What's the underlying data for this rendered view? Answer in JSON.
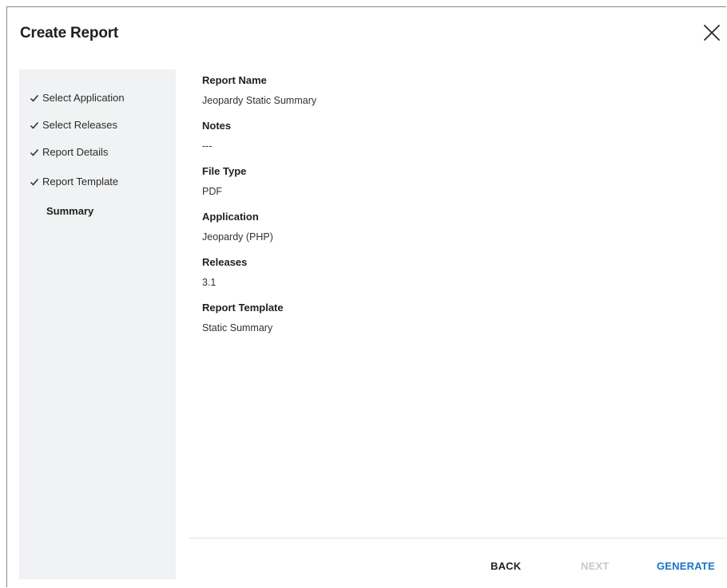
{
  "dialog": {
    "title": "Create Report",
    "close_icon": "close-icon"
  },
  "sidebar": {
    "steps": [
      {
        "label": "Select Application",
        "completed": true,
        "icon": "checkmark-icon"
      },
      {
        "label": "Select Releases",
        "completed": true,
        "icon": "checkmark-icon"
      },
      {
        "label": "Report Details",
        "completed": true,
        "icon": "checkmark-icon"
      },
      {
        "label": "Report Template",
        "completed": true,
        "icon": "checkmark-icon"
      },
      {
        "label": "Summary",
        "completed": false,
        "current": true
      }
    ]
  },
  "summary": {
    "fields": [
      {
        "label": "Report Name",
        "value": "Jeopardy Static Summary"
      },
      {
        "label": "Notes",
        "value": "---"
      },
      {
        "label": "File Type",
        "value": "PDF"
      },
      {
        "label": "Application",
        "value": "Jeopardy (PHP)"
      },
      {
        "label": "Releases",
        "value": "3.1"
      },
      {
        "label": "Report Template",
        "value": "Static Summary"
      }
    ]
  },
  "footer": {
    "back_label": "BACK",
    "next_label": "NEXT",
    "generate_label": "GENERATE",
    "next_enabled": false
  },
  "colors": {
    "accent": "#1a73c9",
    "sidebar_bg": "#f1f2f3",
    "disabled_text": "#c9c9c9"
  }
}
